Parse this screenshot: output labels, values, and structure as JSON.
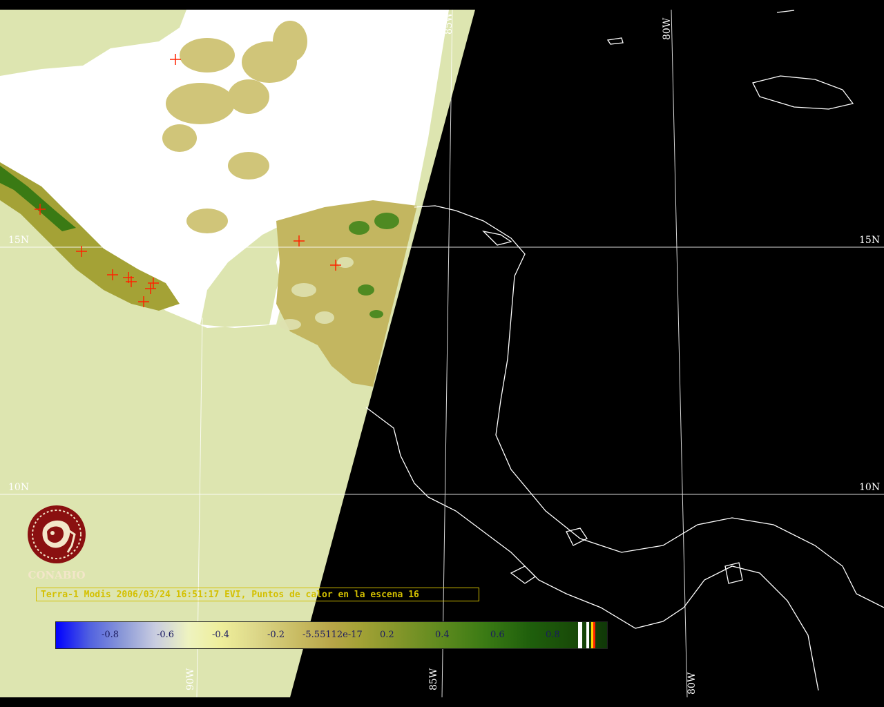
{
  "map": {
    "lat_labels": [
      "15N",
      "10N"
    ],
    "lon_labels": [
      "85W",
      "80W",
      "90W"
    ],
    "colors": {
      "background": "#000000",
      "no_data": "#dde5b0",
      "cloud": "#ffffff",
      "coastline": "#ffffff",
      "grid": "#ffffff",
      "hotspot": "#ff2200"
    }
  },
  "logo": {
    "text": "CONABIO",
    "icon": "conabio-emblem-icon",
    "color": "#8a1010"
  },
  "caption": {
    "text": "Terra-1 Modis 2006/03/24 16:51:17 EVI, Puntos de calor en la escena 16"
  },
  "colorbar": {
    "ticks": [
      "-0.8",
      "-0.6",
      "-0.4",
      "-0.2",
      "-5.55112e-17",
      "0.2",
      "0.4",
      "0.6",
      "0.8"
    ],
    "range": [
      -1,
      1
    ],
    "end_swatches": [
      "#ffffff",
      "#ffffff",
      "#ffd000",
      "#ff2000"
    ]
  }
}
